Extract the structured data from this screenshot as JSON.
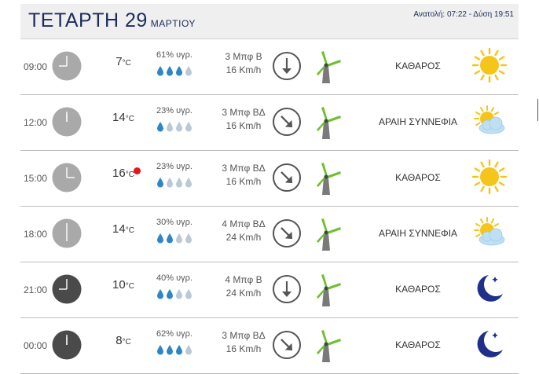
{
  "header": {
    "day": "ΤΕΤΑΡΤΗ 29",
    "month": "ΜΑΡΤΙΟΥ",
    "sunrise_sunset": "Ανατολή: 07:22 - Δύση 19:51"
  },
  "colors": {
    "drop_full": "#2f86c7",
    "drop_empty": "#b9c9d6",
    "clock_day": "#a9a9a9",
    "clock_night": "#4a4a4a",
    "hot_dot": "#e8141a"
  },
  "rows": [
    {
      "time": "09:00",
      "hour": 9,
      "clock": "day",
      "temp": "7",
      "unit": "°C",
      "hot": false,
      "humidity": "61% υγρ.",
      "drops_filled": 3,
      "wind_bf": "3 Μπφ Β",
      "wind_kmh": "16 Km/h",
      "direction": "S",
      "mill_icon": "windmill-icon",
      "desc": "ΚΑΘΑΡΟΣ",
      "icon": "sun-icon"
    },
    {
      "time": "12:00",
      "hour": 12,
      "clock": "day",
      "temp": "14",
      "unit": "°C",
      "hot": false,
      "humidity": "23% υγρ.",
      "drops_filled": 1,
      "wind_bf": "3 Μπφ ΒΔ",
      "wind_kmh": "16 Km/h",
      "direction": "SE",
      "mill_icon": "windmill-icon",
      "desc": "ΑΡΑΙΗ ΣΥΝΝΕΦΙΑ",
      "icon": "sun-cloud-icon"
    },
    {
      "time": "15:00",
      "hour": 15,
      "clock": "day",
      "temp": "16",
      "unit": "°C",
      "hot": true,
      "humidity": "23% υγρ.",
      "drops_filled": 1,
      "wind_bf": "3 Μπφ ΒΔ",
      "wind_kmh": "16 Km/h",
      "direction": "SE",
      "mill_icon": "windmill-icon",
      "desc": "ΚΑΘΑΡΟΣ",
      "icon": "sun-icon"
    },
    {
      "time": "18:00",
      "hour": 18,
      "clock": "day",
      "temp": "14",
      "unit": "°C",
      "hot": false,
      "humidity": "30% υγρ.",
      "drops_filled": 2,
      "wind_bf": "4 Μπφ ΒΔ",
      "wind_kmh": "24 Km/h",
      "direction": "SE",
      "mill_icon": "windmill-icon",
      "desc": "ΑΡΑΙΗ ΣΥΝΝΕΦΙΑ",
      "icon": "sun-cloud-icon"
    },
    {
      "time": "21:00",
      "hour": 21,
      "clock": "night",
      "temp": "10",
      "unit": "°C",
      "hot": false,
      "humidity": "40% υγρ.",
      "drops_filled": 2,
      "wind_bf": "4 Μπφ Β",
      "wind_kmh": "24 Km/h",
      "direction": "S",
      "mill_icon": "windmill-icon",
      "desc": "ΚΑΘΑΡΟΣ",
      "icon": "moon-icon"
    },
    {
      "time": "00:00",
      "hour": 0,
      "clock": "night",
      "temp": "8",
      "unit": "°C",
      "hot": false,
      "humidity": "62% υγρ.",
      "drops_filled": 3,
      "wind_bf": "3 Μπφ ΒΔ",
      "wind_kmh": "16 Km/h",
      "direction": "SE",
      "mill_icon": "windmill-icon",
      "desc": "ΚΑΘΑΡΟΣ",
      "icon": "moon-icon"
    }
  ]
}
